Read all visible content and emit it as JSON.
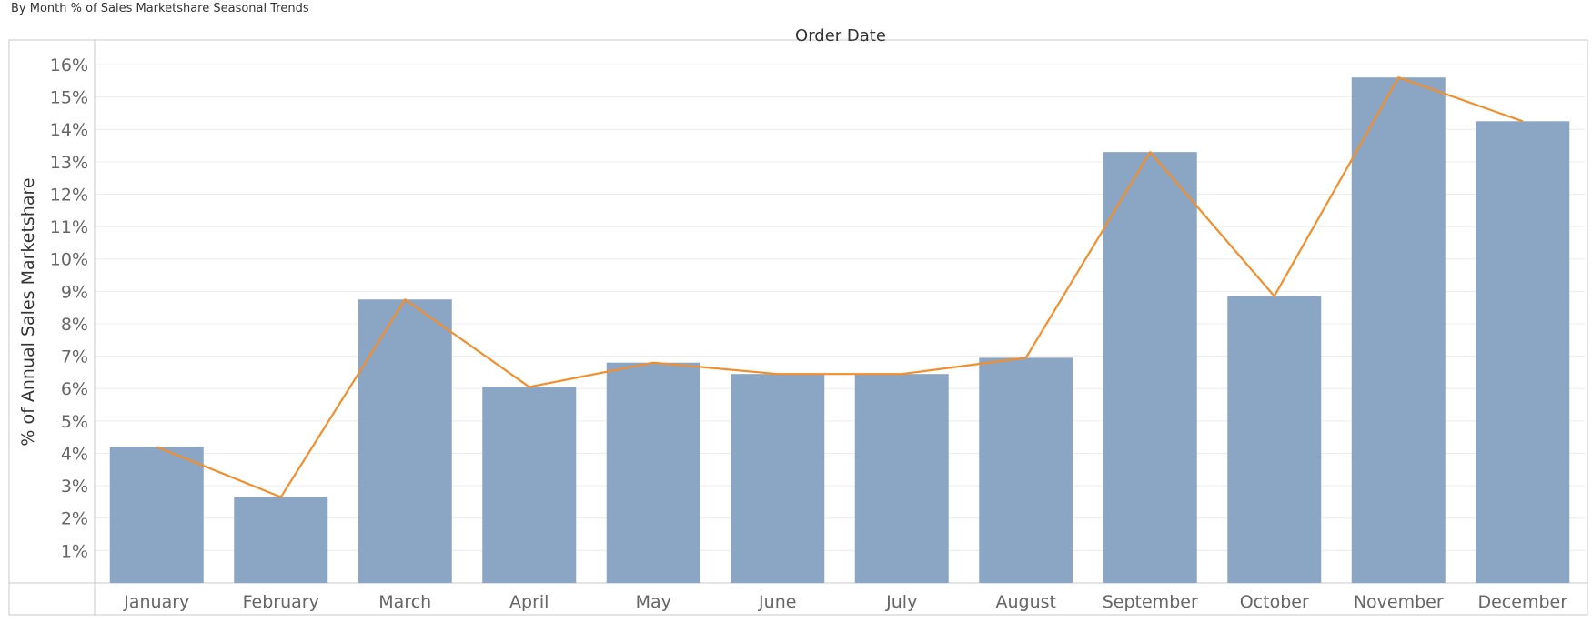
{
  "worksheet": {
    "title": "By Month % of Sales Marketshare Seasonal Trends"
  },
  "chart_data": {
    "type": "bar",
    "title": "Order Date",
    "xlabel": "",
    "ylabel": "% of Annual Sales Marketshare",
    "categories": [
      "January",
      "February",
      "March",
      "April",
      "May",
      "June",
      "July",
      "August",
      "September",
      "October",
      "November",
      "December"
    ],
    "series": [
      {
        "type": "bar",
        "values": [
          4.2,
          2.65,
          8.75,
          6.05,
          6.8,
          6.45,
          6.45,
          6.95,
          13.3,
          8.85,
          15.6,
          14.25
        ]
      },
      {
        "type": "line",
        "values": [
          4.2,
          2.65,
          8.75,
          6.05,
          6.8,
          6.45,
          6.45,
          6.95,
          13.3,
          8.85,
          15.6,
          14.25
        ]
      }
    ],
    "ylim": [
      0,
      16.7
    ],
    "yticks": [
      "1%",
      "2%",
      "3%",
      "4%",
      "5%",
      "6%",
      "7%",
      "8%",
      "9%",
      "10%",
      "11%",
      "12%",
      "13%",
      "14%",
      "15%",
      "16%"
    ],
    "ytick_values": [
      1,
      2,
      3,
      4,
      5,
      6,
      7,
      8,
      9,
      10,
      11,
      12,
      13,
      14,
      15,
      16
    ],
    "grid": true,
    "colors": {
      "bar": "#8aa6c4",
      "line": "#f28e2b",
      "grid": "#ececec",
      "axis": "#c8c8c8",
      "tick_text": "#666666",
      "label_text": "#333333"
    }
  }
}
